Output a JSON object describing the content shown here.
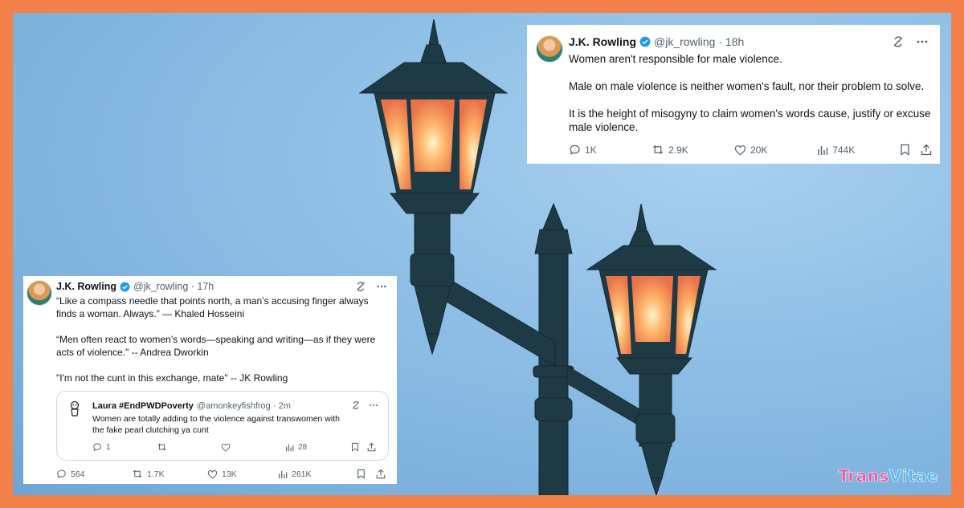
{
  "tweet_right": {
    "author_name": "J.K. Rowling",
    "handle": "@jk_rowling",
    "age": "18h",
    "lines": [
      "Women aren't responsible for male violence.",
      "Male on male violence is neither women's fault, nor their problem to solve.",
      "It is the height of misogyny to claim women's words cause, justify or excuse male violence."
    ],
    "replies": "1K",
    "retweets": "2.9K",
    "likes": "20K",
    "views": "744K"
  },
  "tweet_left": {
    "author_name": "J.K. Rowling",
    "handle": "@jk_rowling",
    "age": "17h",
    "lines": [
      "“Like a compass needle that points north, a man’s accusing finger always finds a woman. Always.” — Khaled Hosseini",
      "“Men often react to women’s words—speaking and writing—as if they were acts of violence.\" -- Andrea Dworkin",
      "\"I'm not the cunt in this exchange, mate\" -- JK Rowling"
    ],
    "replies": "564",
    "retweets": "1.7K",
    "likes": "13K",
    "views": "261K",
    "quote": {
      "author_name": "Laura #EndPWDPoverty",
      "handle": "@amonkeyfishfrog",
      "age": "2m",
      "text": "Women are totally adding to the violence against transwomen with the fake pearl clutching ya cunt",
      "replies": "1",
      "views": "28"
    }
  },
  "brand": {
    "part1": "Trans",
    "part2": "Vitae",
    "color1": "#f2509b",
    "color2": "#56b7e6"
  },
  "colors": {
    "frame": "#f4804a",
    "verified": "#1d9bf0"
  }
}
